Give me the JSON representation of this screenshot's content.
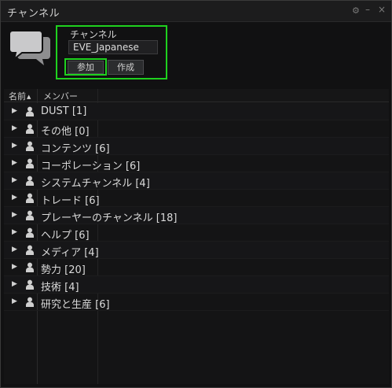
{
  "window": {
    "title": "チャンネル",
    "controls": {
      "gear": "⚙",
      "minimize": "–",
      "close": "×"
    }
  },
  "channel_panel": {
    "label": "チャンネル",
    "input_value": "EVE_Japanese",
    "join_label": "参加",
    "create_label": "作成",
    "highlight_color": "#1fd11f"
  },
  "list": {
    "columns": {
      "name": "名前",
      "sort_indicator": "▲",
      "members": "メンバー"
    },
    "rows": [
      {
        "label": "DUST [1]"
      },
      {
        "label": "その他 [0]"
      },
      {
        "label": "コンテンツ [6]"
      },
      {
        "label": "コーポレーション [6]"
      },
      {
        "label": "システムチャンネル [4]"
      },
      {
        "label": "トレード [6]"
      },
      {
        "label": "プレーヤーのチャンネル [18]"
      },
      {
        "label": "ヘルプ [6]"
      },
      {
        "label": "メディア [4]"
      },
      {
        "label": "勢力 [20]"
      },
      {
        "label": "技術 [4]"
      },
      {
        "label": "研究と生産 [6]"
      }
    ],
    "expander_glyph": "▶",
    "row_icon": "person-icon"
  }
}
